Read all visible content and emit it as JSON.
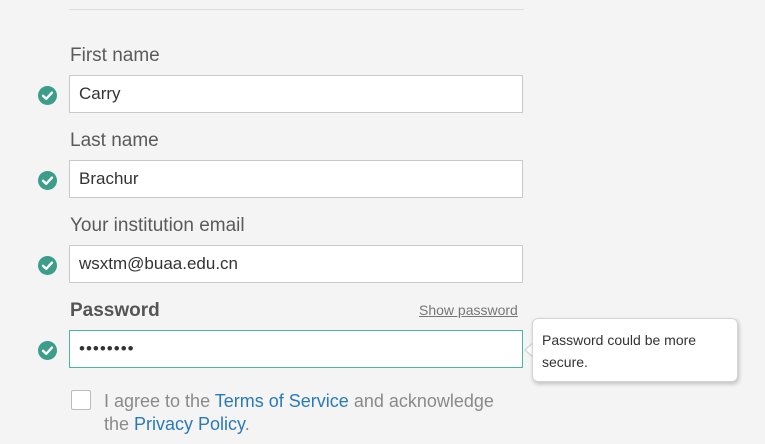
{
  "form": {
    "first_name": {
      "label": "First name",
      "value": "Carry",
      "valid": true
    },
    "last_name": {
      "label": "Last name",
      "value": "Brachur",
      "valid": true
    },
    "email": {
      "label": "Your institution email",
      "value": "wsxtm@buaa.edu.cn",
      "valid": true
    },
    "password": {
      "label": "Password",
      "value": "••••••••",
      "show_label": "Show password",
      "valid": true,
      "tooltip": "Password could be more secure."
    },
    "agreement": {
      "checked": false,
      "text_before": "I agree to the ",
      "terms_link": "Terms of Service",
      "text_middle": " and acknowledge the ",
      "privacy_link": "Privacy Policy",
      "text_after": "."
    }
  },
  "colors": {
    "valid_check": "#3c9d8b",
    "focus_border": "#48b6a3",
    "link": "#2a7ab9"
  }
}
